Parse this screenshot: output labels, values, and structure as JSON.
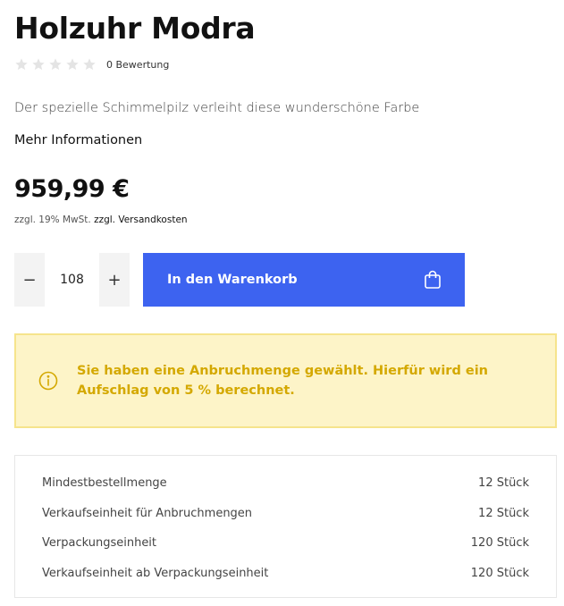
{
  "product": {
    "title": "Holzuhr Modra",
    "rating": {
      "stars_filled": 0,
      "stars_total": 5,
      "count_label": "0 Bewertung"
    },
    "description": "Der spezielle Schimmelpilz verleiht diese wunderschöne Farbe",
    "more_info_label": "Mehr Informationen",
    "price": "959,99 €",
    "tax_note": "zzgl. 19% MwSt.",
    "shipping_link": "zzgl. Versandkosten"
  },
  "buy_box": {
    "quantity": "108",
    "decrement_symbol": "−",
    "increment_symbol": "+",
    "add_to_cart_label": "In den Warenkorb",
    "cart_icon": "shopping-bag-icon"
  },
  "alert": {
    "icon": "info-icon",
    "text": "Sie haben eine Anbruchmenge gewählt. Hierfür wird ein Aufschlag von 5 % berechnet.",
    "text_color": "#d4a800",
    "background": "#fdf4c8",
    "border": "#f6e48c"
  },
  "details": [
    {
      "label": "Mindestbestellmenge",
      "value": "12 Stück"
    },
    {
      "label": "Verkaufseinheit für Anbruchmengen",
      "value": "12 Stück"
    },
    {
      "label": "Verpackungseinheit",
      "value": "120 Stück"
    },
    {
      "label": "Verkaufseinheit ab Verpackungseinheit",
      "value": "120 Stück"
    }
  ],
  "colors": {
    "accent": "#3d63f0",
    "star_empty": "#e4e4e4"
  }
}
